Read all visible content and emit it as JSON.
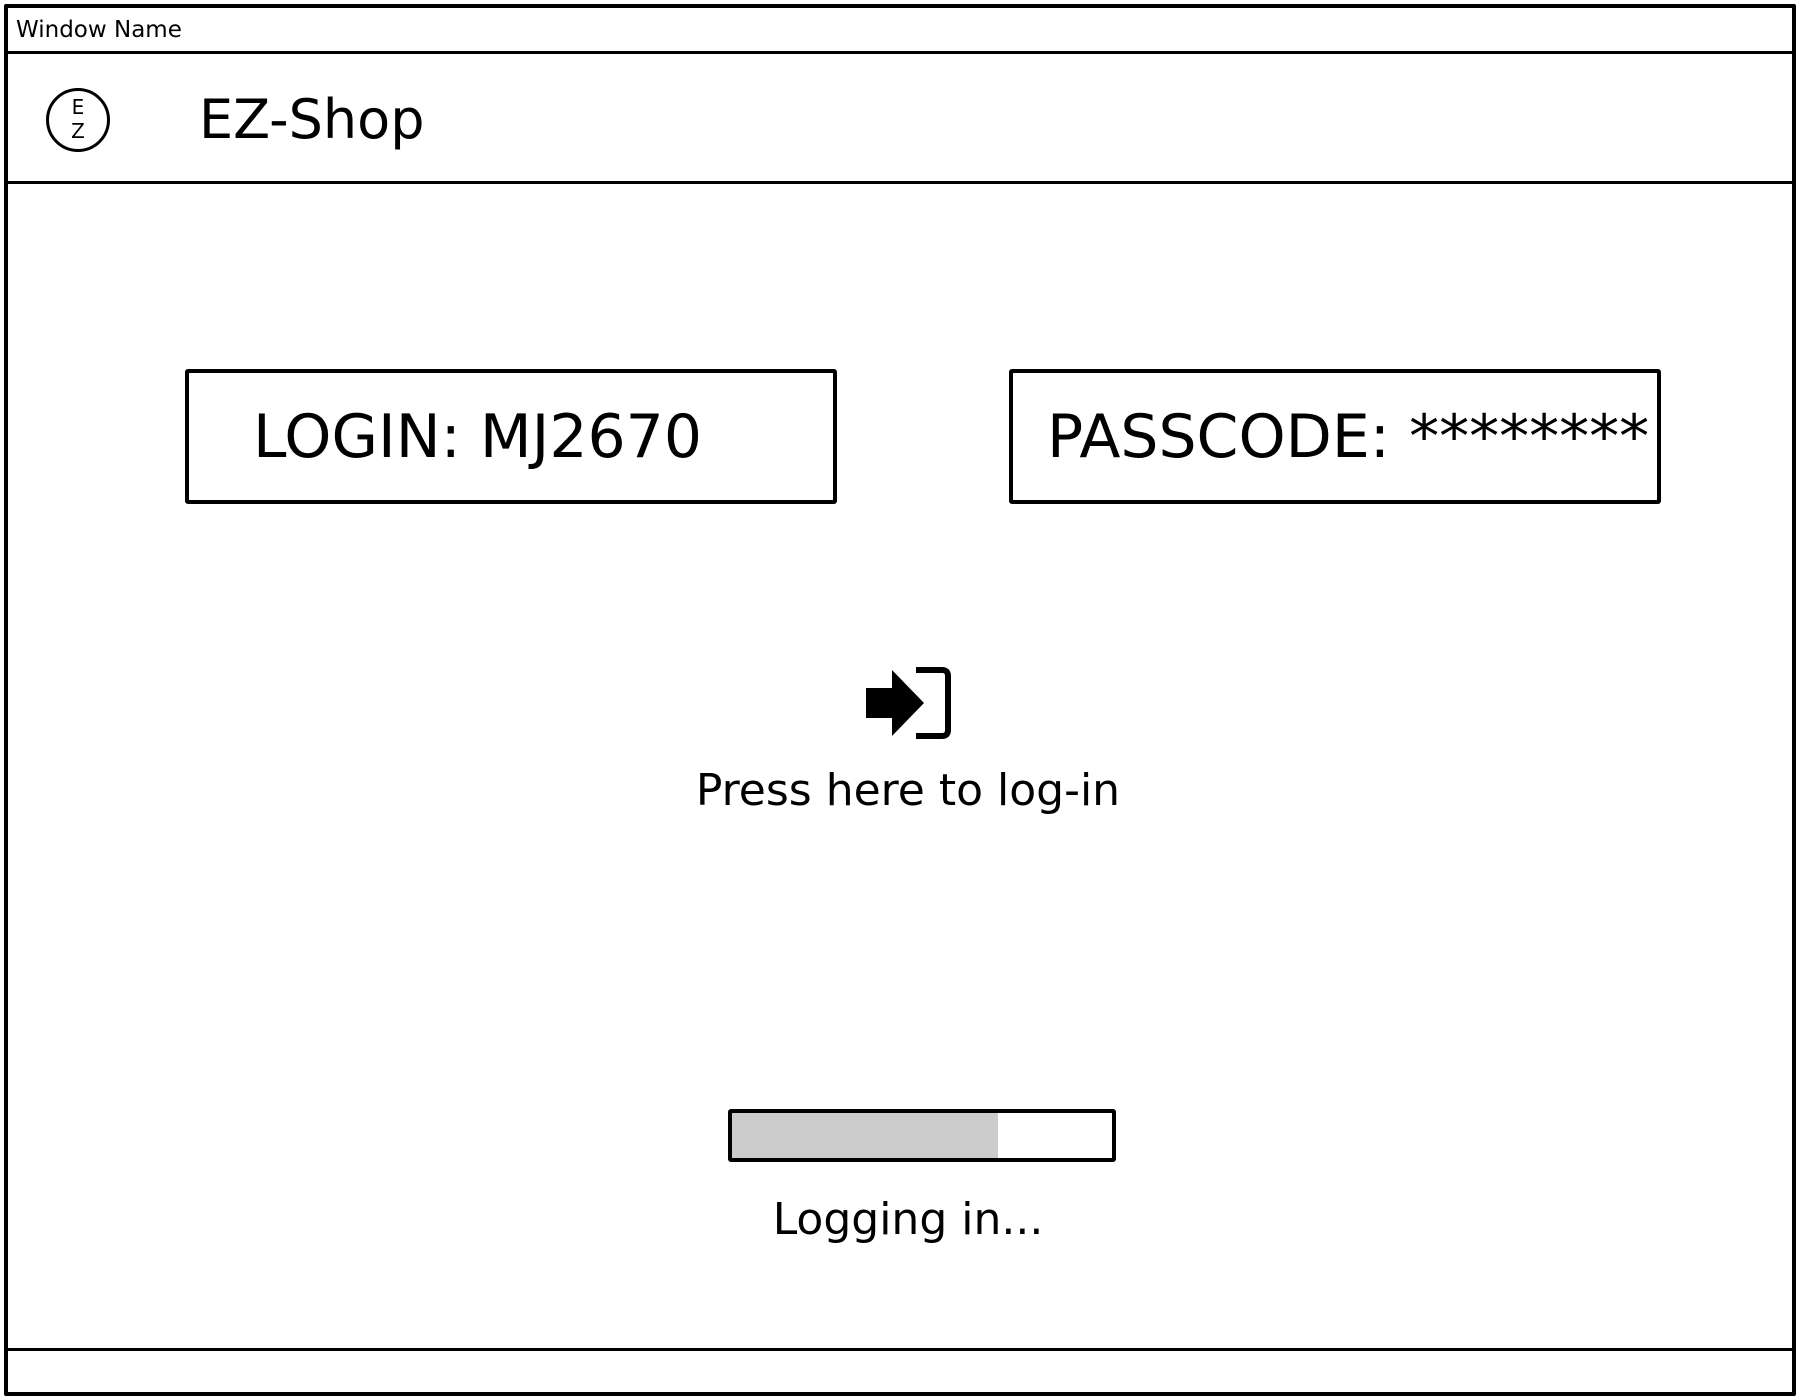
{
  "window": {
    "title": "Window Name"
  },
  "header": {
    "logo_top": "E",
    "logo_bottom": "Z",
    "app_name": "EZ-Shop"
  },
  "login_form": {
    "login_text": "LOGIN: MJ2670",
    "passcode_text": "PASSCODE: ********"
  },
  "login_action": {
    "icon": "sign-in-icon",
    "label": "Press here to log-in"
  },
  "progress": {
    "fraction": 0.7,
    "status_text": "Logging in...",
    "fill_color": "#cccccc"
  }
}
